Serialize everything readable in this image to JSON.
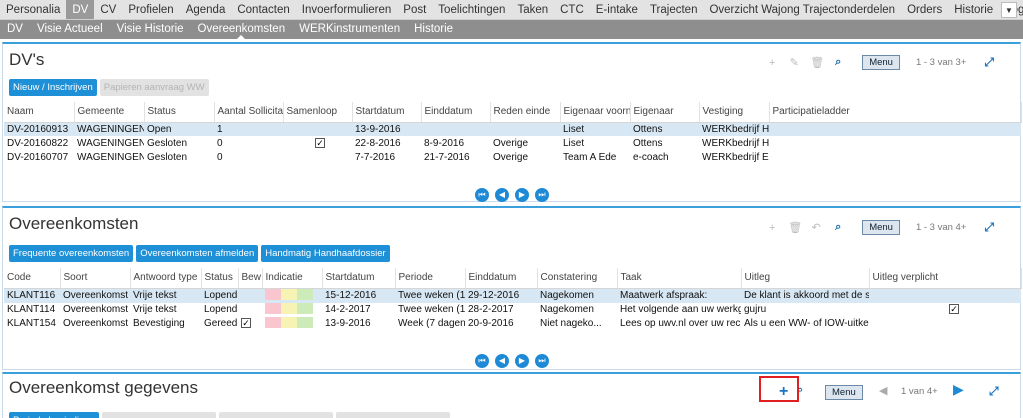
{
  "topnav": {
    "items": [
      "Personalia",
      "DV",
      "CV",
      "Profielen",
      "Agenda",
      "Contacten",
      "Invoerformulieren",
      "Post",
      "Toelichtingen",
      "Taken",
      "CTC",
      "E-intake",
      "Trajecten",
      "Overzicht Wajong Trajectonderdelen",
      "Orders",
      "Historie",
      "Log"
    ],
    "active_index": 1,
    "dropdown_glyph": "▼"
  },
  "subnav": {
    "items": [
      "DV",
      "Visie Actueel",
      "Visie Historie",
      "Overeenkomsten",
      "WERKinstrumenten",
      "Historie"
    ],
    "active_index": 3
  },
  "dvs": {
    "title": "DV's",
    "menu_label": "Menu",
    "pager": "1 - 3 van 3+",
    "buttons": [
      {
        "label": "Nieuw / Inschrijven",
        "enabled": true
      },
      {
        "label": "Papieren aanvraag WW",
        "enabled": false
      }
    ],
    "columns": [
      "Naam",
      "Gemeente",
      "Status",
      "Aantal Sollicitat",
      "Samenloop",
      "Startdatum",
      "Einddatum",
      "Reden einde",
      "Eigenaar voorna",
      "Eigenaar",
      "Vestiging",
      "Participatieladder"
    ],
    "rows": [
      {
        "naam": "DV-20160913",
        "gemeente": "WAGENINGEN",
        "status": "Open",
        "aantal": "1",
        "samenloop": false,
        "start": "13-9-2016",
        "eind": "",
        "reden": "",
        "voornaam": "Liset",
        "eigenaar": "Ottens",
        "vestiging": "WERKbedrijf H...",
        "ladder": "",
        "selected": true
      },
      {
        "naam": "DV-20160822",
        "gemeente": "WAGENINGEN",
        "status": "Gesloten",
        "aantal": "0",
        "samenloop": true,
        "start": "22-8-2016",
        "eind": "8-9-2016",
        "reden": "Overige",
        "voornaam": "Liset",
        "eigenaar": "Ottens",
        "vestiging": "WERKbedrijf H...",
        "ladder": "",
        "selected": false
      },
      {
        "naam": "DV-20160707",
        "gemeente": "WAGENINGEN",
        "status": "Gesloten",
        "aantal": "0",
        "samenloop": false,
        "start": "7-7-2016",
        "eind": "21-7-2016",
        "reden": "Overige",
        "voornaam": "Team A Ede",
        "eigenaar": "e-coach",
        "vestiging": "WERKbedrijf E...",
        "ladder": "",
        "selected": false
      }
    ]
  },
  "overeenkomsten": {
    "title": "Overeenkomsten",
    "menu_label": "Menu",
    "pager": "1 - 3 van 4+",
    "buttons": [
      {
        "label": "Frequente overeenkomsten",
        "enabled": true
      },
      {
        "label": "Overeenkomsten afmelden",
        "enabled": true
      },
      {
        "label": "Handmatig Handhaafdossier",
        "enabled": true
      }
    ],
    "columns": [
      "Code",
      "Soort",
      "Antwoord type",
      "Status",
      "Bew",
      "Indicatie",
      "Startdatum",
      "Periode",
      "Einddatum",
      "Constatering",
      "Taak",
      "Uitleg",
      "Uitleg verplicht"
    ],
    "rows": [
      {
        "code": "KLANT116",
        "soort": "Overeenkomst",
        "antwoord": "Vrije tekst",
        "status": "Lopend",
        "bew": false,
        "start": "15-12-2016",
        "periode": "Twee weken (1...",
        "eind": "29-12-2016",
        "constatering": "Nagekomen",
        "taak": "Maatwerk afspraak:",
        "uitleg": "De klant is akkoord met de sp",
        "verplicht": false,
        "selected": true
      },
      {
        "code": "KLANT114",
        "soort": "Overeenkomst",
        "antwoord": "Vrije tekst",
        "status": "Lopend",
        "bew": false,
        "start": "14-2-2017",
        "periode": "Twee weken (1...",
        "eind": "28-2-2017",
        "constatering": "Nagekomen",
        "taak": "Het volgende aan uw werkg...",
        "uitleg": "gujru",
        "verplicht": true,
        "selected": false
      },
      {
        "code": "KLANT154",
        "soort": "Overeenkomst",
        "antwoord": "Bevestiging",
        "status": "Gereed",
        "bew": true,
        "start": "13-9-2016",
        "periode": "Week (7 dagen)",
        "eind": "20-9-2016",
        "constatering": "Niet nageko...",
        "taak": "Lees op uwv.nl over uw rec...",
        "uitleg": "Als u een WW- of IOW-uitkerin",
        "verplicht": false,
        "selected": false
      }
    ],
    "indicatie_colors": [
      "#f9c6cf",
      "#f6f3b4",
      "#cdebb8"
    ]
  },
  "gegevens": {
    "title": "Overeenkomst gegevens",
    "menu_label": "Menu",
    "pager": "1 van 4+",
    "add_glyph": "+",
    "buttons": [
      {
        "label": "Periode beeindigen",
        "enabled": true
      },
      {
        "label": "",
        "enabled": false
      },
      {
        "label": "",
        "enabled": false
      },
      {
        "label": "",
        "enabled": false
      }
    ]
  },
  "icons": {
    "add": "+",
    "edit": "✎",
    "delete": "🗑",
    "search": "🔍",
    "expand": "⤢",
    "first": "⏮",
    "prev": "◀",
    "next": "▶",
    "last": "⏭"
  },
  "colors": {
    "accent": "#1e90d8",
    "selected_row": "#d7e7f3",
    "highlight": "#e02020"
  }
}
